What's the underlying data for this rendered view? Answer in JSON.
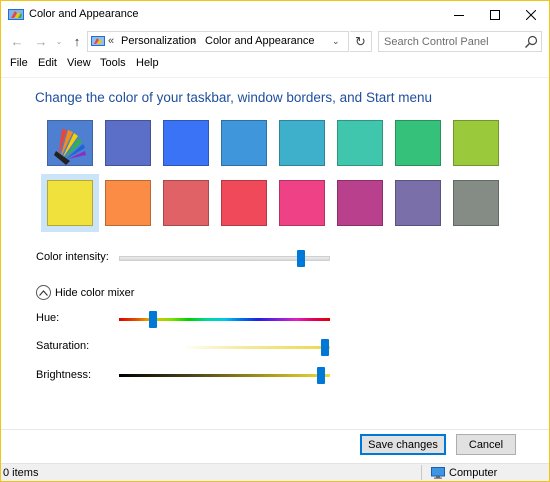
{
  "window": {
    "title": "Color and Appearance",
    "controls": {
      "minimize": "—",
      "maximize": "☐",
      "close": "✕"
    }
  },
  "address": {
    "back_glyph": "←",
    "forward_glyph": "→",
    "history_glyph": "⌄",
    "up_glyph": "↑",
    "root_sep": "«",
    "crumbs": [
      "Personalization",
      "Color and Appearance"
    ],
    "chevron": "›",
    "dropdown_glyph": "⌄",
    "refresh_glyph": "↻",
    "search_placeholder": "Search Control Panel"
  },
  "menu": [
    "File",
    "Edit",
    "View",
    "Tools",
    "Help"
  ],
  "content": {
    "heading": "Change the color of your taskbar, window borders, and Start menu",
    "swatches_row1": [
      "#auto",
      "#5b6fc9",
      "#3b73f6",
      "#3f96db",
      "#3fb0cc",
      "#3fc6ac",
      "#35c17a",
      "#9aca3c"
    ],
    "swatches_row2": [
      "#f0e13c",
      "#fa8c46",
      "#e06267",
      "#f04a5a",
      "#ef4286",
      "#b9408c",
      "#7a6fa8",
      "#858c85"
    ],
    "selected_color": "#f0e13c",
    "intensity_label": "Color intensity:",
    "intensity_value": 0.86,
    "mixer_toggle_label": "Hide color mixer",
    "hue_label": "Hue:",
    "hue_value": 0.16,
    "saturation_label": "Saturation:",
    "saturation_value": 0.97,
    "brightness_label": "Brightness:",
    "brightness_value": 0.96,
    "accent_color": "#0078d7",
    "heading_color": "#1e4e9e"
  },
  "buttons": {
    "save": "Save changes",
    "cancel": "Cancel"
  },
  "status": {
    "items": "0 items",
    "location": "Computer"
  }
}
